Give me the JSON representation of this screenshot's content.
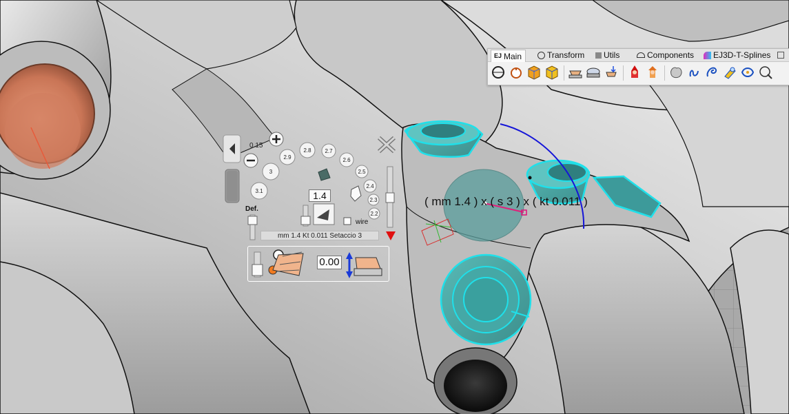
{
  "ribbon": {
    "tabs": [
      {
        "label": "Main",
        "icon": "ej-logo-icon",
        "active": true
      },
      {
        "label": "Transform",
        "icon": "transform-icon"
      },
      {
        "label": "Utils",
        "icon": "utils-icon"
      },
      {
        "label": "Components",
        "icon": "components-icon"
      },
      {
        "label": "EJ3D-T-Splines",
        "icon": "t-splines-icon"
      }
    ],
    "tools": [
      "ring-size-icon",
      "ring-tool-icon",
      "box-orange-icon",
      "box-yellow-icon",
      "gem-setting-icon",
      "bezel-icon",
      "prong-icon",
      "gnome-red-icon",
      "gnome-orange-icon",
      "blob-icon",
      "curve-hook-icon",
      "curve-spiral-icon",
      "pave-icon",
      "flow-icon",
      "loop-icon"
    ]
  },
  "gem_selector": {
    "ring_values": [
      "3.1",
      "3",
      "2.9",
      "2.8",
      "2.7",
      "2.6",
      "2.5",
      "2.4",
      "2.3",
      "2.2"
    ],
    "small_value": "0.15",
    "size_value": "1.4",
    "def_label": "Def.",
    "wire_label": "wire",
    "status": "mm 1.4  Kt 0.011  Setaccio 3",
    "offset_value": "0.00",
    "close_icon": "close-x-icon"
  },
  "viewport": {
    "dimension_label": "( mm 1.4 ) x ( s 3 ) x ( kt 0.011 )",
    "highlight_color": "#1fe0ea"
  }
}
